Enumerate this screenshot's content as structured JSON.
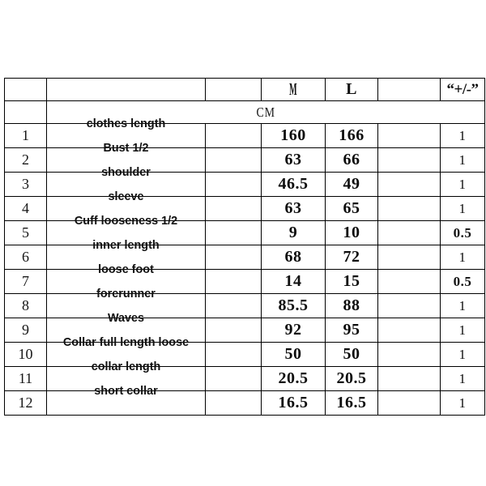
{
  "table": {
    "columns": {
      "number": "",
      "item": "",
      "blank_a": "",
      "size_m": "M",
      "size_l": "L",
      "blank_b": "",
      "tolerance": "“+/-”"
    },
    "unit_label": "CM",
    "rows": [
      {
        "no": "1",
        "item": "clothes length",
        "m": "160",
        "l": "166",
        "tol": "1"
      },
      {
        "no": "2",
        "item": "Bust 1/2",
        "m": "63",
        "l": "66",
        "tol": "1"
      },
      {
        "no": "3",
        "item": "shoulder",
        "m": "46.5",
        "l": "49",
        "tol": "1"
      },
      {
        "no": "4",
        "item": "sleeve",
        "m": "63",
        "l": "65",
        "tol": "1"
      },
      {
        "no": "5",
        "item": "Cuff looseness 1/2",
        "m": "9",
        "l": "10",
        "tol": "0.5"
      },
      {
        "no": "6",
        "item": "inner length",
        "m": "68",
        "l": "72",
        "tol": "1"
      },
      {
        "no": "7",
        "item": "loose foot",
        "m": "14",
        "l": "15",
        "tol": "0.5"
      },
      {
        "no": "8",
        "item": "forerunner",
        "m": "85.5",
        "l": "88",
        "tol": "1"
      },
      {
        "no": "9",
        "item": "Waves",
        "m": "92",
        "l": "95",
        "tol": "1"
      },
      {
        "no": "10",
        "item": "Collar full length loose",
        "m": "50",
        "l": "50",
        "tol": "1"
      },
      {
        "no": "11",
        "item": "collar length",
        "m": "20.5",
        "l": "20.5",
        "tol": "1"
      },
      {
        "no": "12",
        "item": "short collar",
        "m": "16.5",
        "l": "16.5",
        "tol": "1"
      }
    ]
  },
  "colors": {
    "tolerance_background": "#dfe3ec",
    "grid_line": "#000000",
    "page_background": "#ffffff",
    "text": "#101010"
  }
}
